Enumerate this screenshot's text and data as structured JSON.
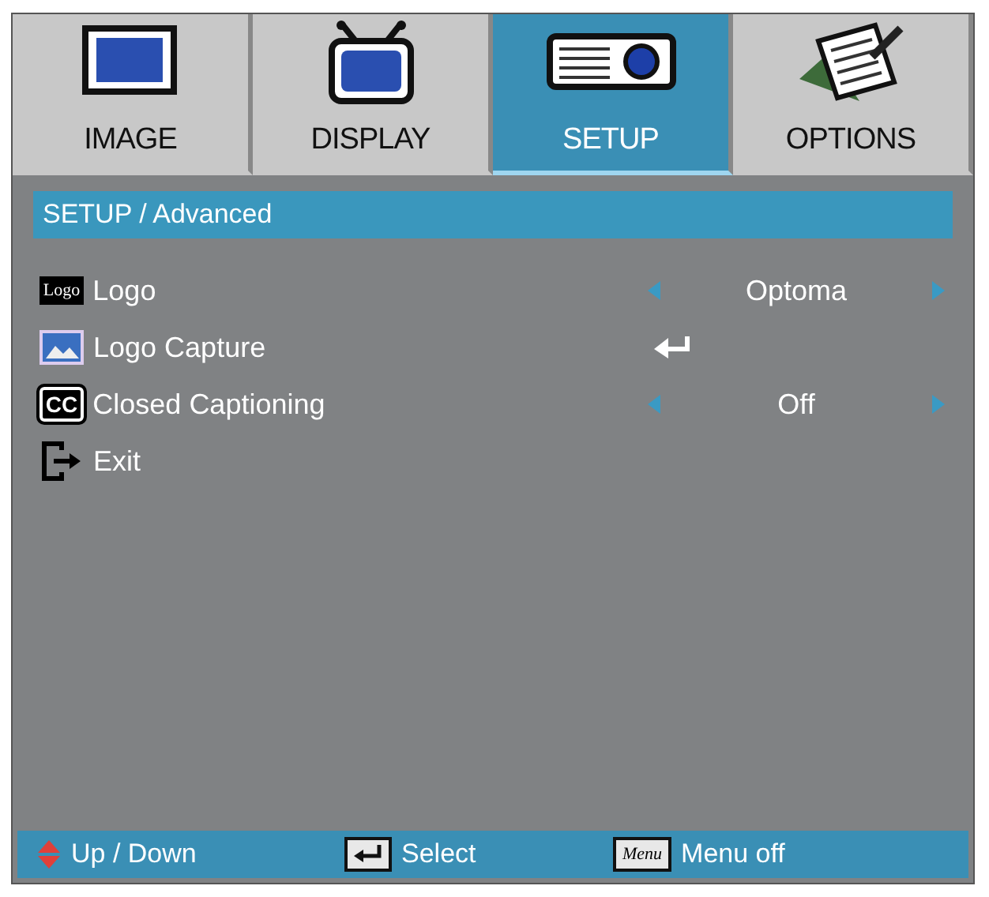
{
  "tabs": [
    {
      "label": "IMAGE",
      "selected": false
    },
    {
      "label": "DISPLAY",
      "selected": false
    },
    {
      "label": "SETUP",
      "selected": true
    },
    {
      "label": "OPTIONS",
      "selected": false
    }
  ],
  "breadcrumb": "SETUP / Advanced",
  "items": [
    {
      "kind": "option",
      "icon_text": "Logo",
      "label": "Logo",
      "value": "Optoma"
    },
    {
      "kind": "action",
      "label": "Logo Capture"
    },
    {
      "kind": "option",
      "icon_text": "CC",
      "label": "Closed Captioning",
      "value": "Off"
    },
    {
      "kind": "exit",
      "label": "Exit"
    }
  ],
  "footer": [
    {
      "kind": "updown",
      "label": "Up / Down"
    },
    {
      "kind": "enter",
      "label": "Select"
    },
    {
      "kind": "menu",
      "key_text": "Menu",
      "label": "Menu off"
    }
  ]
}
